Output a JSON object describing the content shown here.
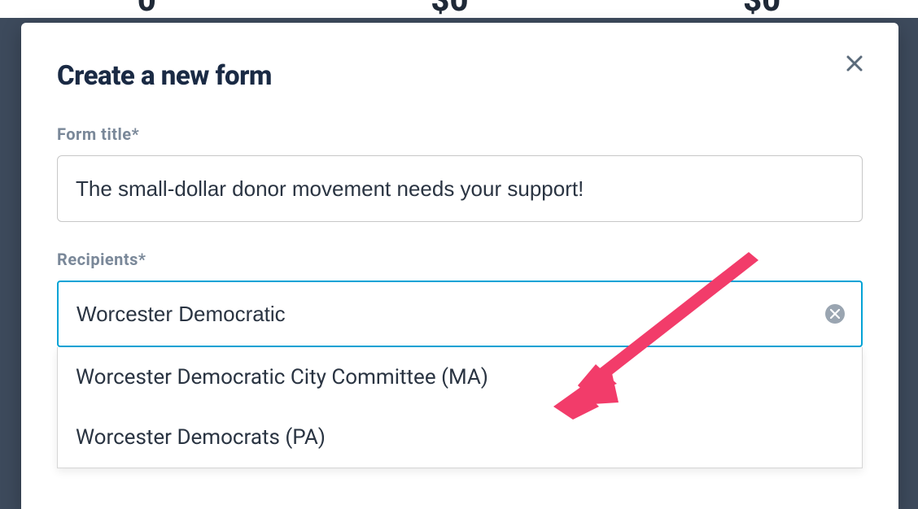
{
  "background": {
    "stat1": "0",
    "stat2": "$0",
    "stat3": "$0"
  },
  "modal": {
    "title": "Create a new form",
    "formTitle": {
      "label": "Form title*",
      "value": "The small-dollar donor movement needs your support!"
    },
    "recipients": {
      "label": "Recipients*",
      "value": "Worcester Democratic",
      "options": [
        "Worcester Democratic City Committee (MA)",
        "Worcester Democrats (PA)"
      ]
    }
  },
  "annotation": {
    "arrow_color": "#f23c6a"
  }
}
